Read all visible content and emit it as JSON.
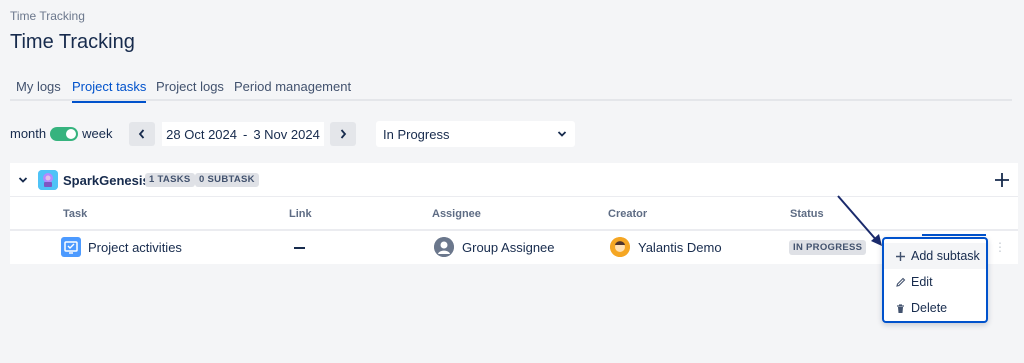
{
  "breadcrumb": "Time Tracking",
  "page_title": "Time Tracking",
  "tabs": [
    {
      "label": "My logs",
      "active": false
    },
    {
      "label": "Project tasks",
      "active": true
    },
    {
      "label": "Project logs",
      "active": false
    },
    {
      "label": "Period management",
      "active": false
    }
  ],
  "period_toggle": {
    "left_label": "month",
    "right_label": "week",
    "state": "week"
  },
  "date_range": {
    "start": "28 Oct 2024",
    "separator": "-",
    "end": "3 Nov 2024"
  },
  "status_filter": {
    "value": "In Progress"
  },
  "project": {
    "name": "SparkGenesis",
    "tasks_badge": "1 TASKS",
    "subtask_badge": "0 SUBTASK"
  },
  "columns": [
    "Task",
    "Link",
    "Assignee",
    "Creator",
    "Status"
  ],
  "rows": [
    {
      "task": "Project activities",
      "link": "—",
      "assignee": "Group Assignee",
      "creator": "Yalantis Demo",
      "status": "IN PROGRESS"
    }
  ],
  "context_menu": {
    "items": [
      {
        "label": "Add subtask",
        "icon": "plus-icon"
      },
      {
        "label": "Edit",
        "icon": "pencil-icon"
      },
      {
        "label": "Delete",
        "icon": "trash-icon"
      }
    ]
  },
  "colors": {
    "accent": "#0052cc",
    "toggle": "#36b37e",
    "background": "#f4f5f7"
  }
}
